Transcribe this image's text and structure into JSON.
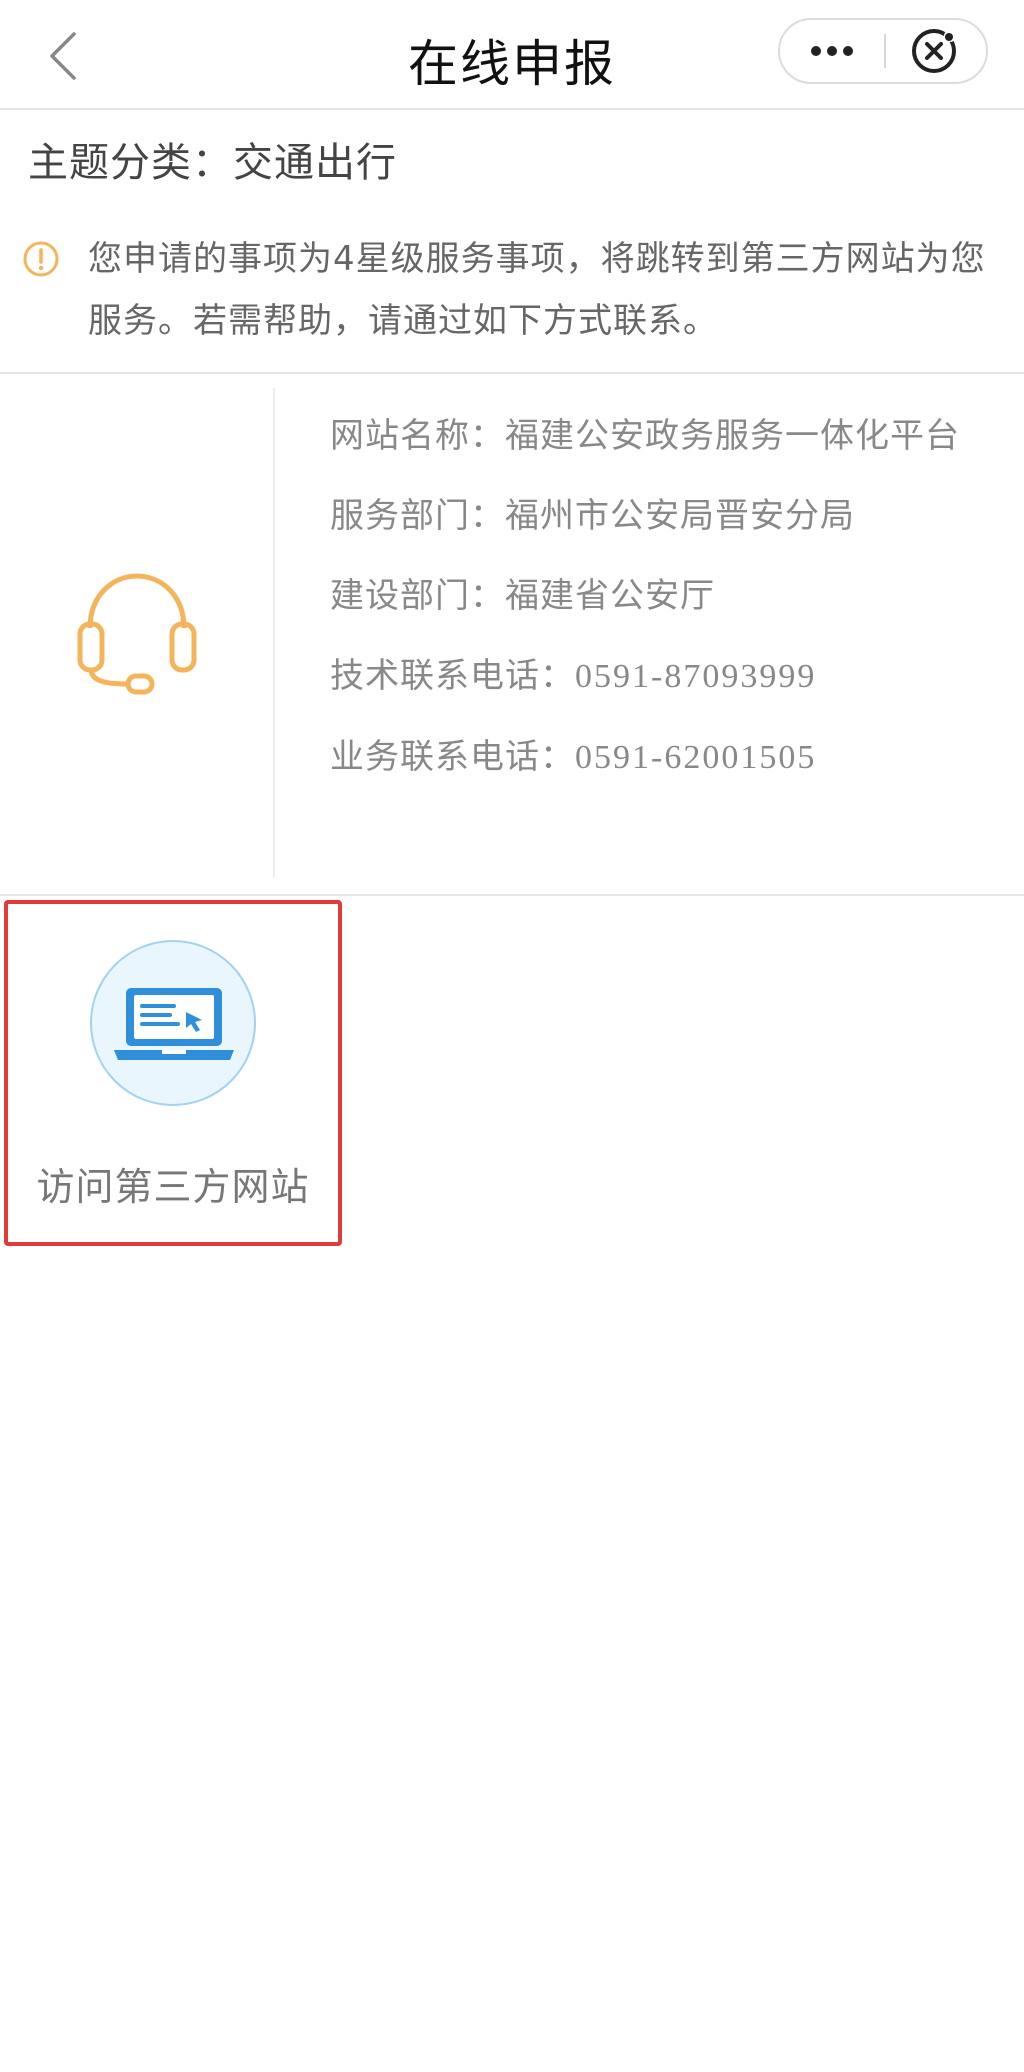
{
  "navbar": {
    "title": "在线申报",
    "back_icon": "chevron-left-icon",
    "more_icon": "more-dots-icon",
    "close_icon": "close-circle-icon"
  },
  "category": {
    "label": "主题分类：",
    "value": "交通出行"
  },
  "notice": {
    "icon": "info-icon",
    "text": "您申请的事项为4星级服务事项，将跳转到第三方网站为您服务。若需帮助，请通过如下方式联系。"
  },
  "contact": {
    "icon": "headset-icon",
    "site_name_label": "网站名称：",
    "site_name_value": "福建公安政务服务一体化平台",
    "service_dept_label": "服务部门：",
    "service_dept_value": "福州市公安局晋安分局",
    "build_dept_label": "建设部门：",
    "build_dept_value": "福建省公安厅",
    "tech_phone_label": "技术联系电话：",
    "tech_phone_value": "0591-87093999",
    "biz_phone_label": "业务联系电话：",
    "biz_phone_value": "0591-62001505"
  },
  "visit": {
    "icon": "laptop-icon",
    "label": "访问第三方网站"
  },
  "colors": {
    "accent_orange": "#f5b35a",
    "accent_blue": "#2f8fdb",
    "highlight_red": "#e03a3a"
  }
}
